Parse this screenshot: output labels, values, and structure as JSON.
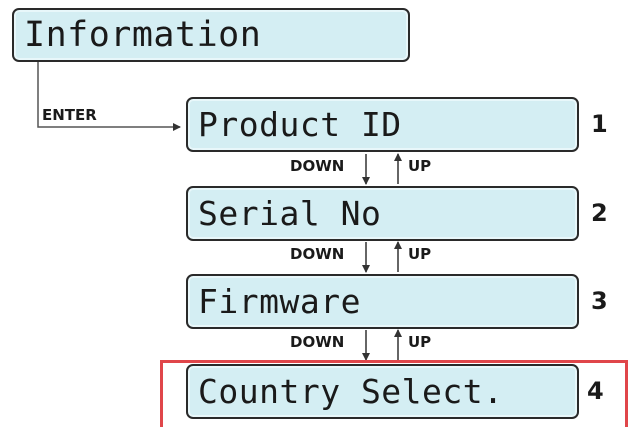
{
  "top_menu": {
    "label": "Information"
  },
  "enter_label": "ENTER",
  "items": [
    {
      "label": "Product ID",
      "number": "1"
    },
    {
      "label": "Serial No",
      "number": "2"
    },
    {
      "label": "Firmware",
      "number": "3"
    },
    {
      "label": "Country Select.",
      "number": "4"
    }
  ],
  "nav": {
    "down": "DOWN",
    "up": "UP"
  },
  "colors": {
    "lcd_fill": "#d4eef3",
    "highlight": "#e0464a",
    "stroke": "#2a2a2a"
  }
}
